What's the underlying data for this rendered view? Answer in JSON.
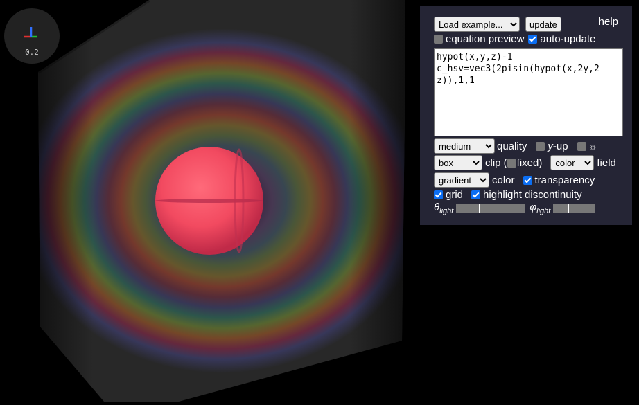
{
  "axes": {
    "scale": "0.2",
    "colors": {
      "x": "#e03030",
      "y": "#20c030",
      "z": "#3070ff"
    }
  },
  "panel": {
    "load_example": "Load example...",
    "update": "update",
    "help": "help",
    "equation_preview": "equation preview",
    "auto_update": "auto-update",
    "equation": "hypot(x,y,z)-1\nc_hsv=vec3(2pisin(hypot(x,2y,2z)),1,1",
    "quality_select": "medium",
    "quality_label": "quality",
    "y_up_var": "y",
    "y_up_suffix": "-up",
    "sun_glyph": "☼",
    "clip_select": "box",
    "clip_label": "clip (",
    "fixed_label": "fixed)",
    "field_select": "color",
    "field_label": "field",
    "color_select": "gradient",
    "color_label": "color",
    "transparency": "transparency",
    "grid": "grid",
    "highlight": "highlight discontinuity",
    "theta_symbol": "θ",
    "phi_symbol": "φ",
    "light_sub": "light",
    "theta_light": 0.33,
    "phi_light": 0.35
  },
  "checkbox_states": {
    "equation_preview": false,
    "auto_update": true,
    "y_up": false,
    "sun": false,
    "fixed": false,
    "transparency": true,
    "grid": true,
    "highlight": true
  }
}
